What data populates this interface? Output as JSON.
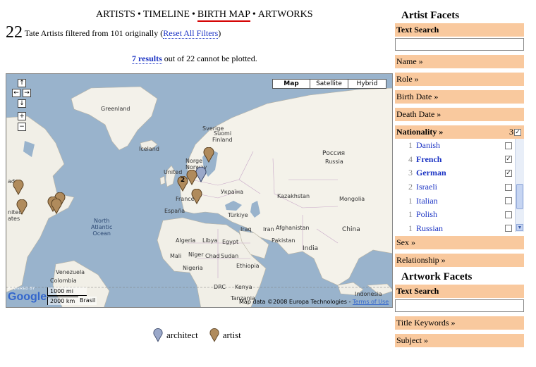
{
  "nav": {
    "items": [
      {
        "label": "ARTISTS"
      },
      {
        "label": "TIMELINE"
      },
      {
        "label": "BIRTH MAP"
      },
      {
        "label": "ARTWORKS"
      }
    ],
    "separator": "•",
    "active": "BIRTH MAP"
  },
  "summary": {
    "count": "22",
    "text": "Tate Artists filtered from 101 originally (",
    "reset_link": "Reset All Filters",
    "close": ")"
  },
  "unplotted": {
    "link": "7 results",
    "text": "out of 22 cannot be plotted."
  },
  "map": {
    "type_buttons": {
      "map": "Map",
      "satellite": "Satellite",
      "hybrid": "Hybrid"
    },
    "controls": {
      "up": "↑",
      "left": "←",
      "right": "→",
      "down": "↓",
      "zoom_in": "+",
      "zoom_out": "−"
    },
    "labels": {
      "greenland": "Greenland",
      "iceland": "Iceland",
      "sweden": "Sverige",
      "suomi": "Suomi",
      "finland": "Finland",
      "norway": "Norge",
      "norway_en": "Norway",
      "russia": "Россия",
      "russia_en": "Russia",
      "uk": "United",
      "ukraine": "Україна",
      "kazakhstan": "Kazakhstan",
      "mongolia": "Mongolia",
      "france": "France",
      "espana": "España",
      "turkiye": "Türkiye",
      "china": "China",
      "afghanistan": "Afghanistan",
      "iraq": "Iraq",
      "iran": "Iran",
      "pakistan": "Pakistan",
      "india": "India",
      "algeria": "Algeria",
      "libya": "Libya",
      "egypt": "Egypt",
      "mali": "Mali",
      "niger": "Niger",
      "chad": "Chad",
      "sudan": "Sudan",
      "ethiopia": "Ethiopia",
      "nigeria": "Nigeria",
      "drc": "DRC",
      "kenya": "Kenya",
      "tanzania": "Tanzania",
      "venezuela": "Venezuela",
      "colombia": "Colombia",
      "brasil": "Brasil",
      "indonesia": "Indonesia",
      "north_atlantic": "North\nAtlantic\nOcean",
      "canada_frag": "ada",
      "us_frag": "nited\nates"
    },
    "scale": {
      "mi": "1000 mi",
      "km": "2000 km",
      "brasil": "Brasil"
    },
    "logo": {
      "powered": "POWERED BY",
      "name": "Google"
    },
    "attribution": "Map data ©2008 Europa Technologies -",
    "terms_link": "Terms of Use",
    "cluster_label": "2"
  },
  "legend": {
    "architect": "architect",
    "artist": "artist",
    "colors": {
      "architect": "#9aa8c9",
      "artist": "#b08b5c"
    }
  },
  "facets": {
    "artist_title": "Artist Facets",
    "text_search": "Text Search",
    "name": "Name »",
    "role": "Role »",
    "birth_date": "Birth Date »",
    "death_date": "Death Date »",
    "nationality": "Nationality »",
    "nationality_count": "3",
    "nationalities": [
      {
        "count": "1",
        "label": "Danish",
        "selected": false
      },
      {
        "count": "4",
        "label": "French",
        "selected": true
      },
      {
        "count": "3",
        "label": "German",
        "selected": true
      },
      {
        "count": "2",
        "label": "Israeli",
        "selected": false
      },
      {
        "count": "1",
        "label": "Italian",
        "selected": false
      },
      {
        "count": "1",
        "label": "Polish",
        "selected": false
      },
      {
        "count": "1",
        "label": "Russian",
        "selected": false
      }
    ],
    "sex": "Sex »",
    "relationship": "Relationship »",
    "artwork_title": "Artwork Facets",
    "artwork_text_search": "Text Search",
    "title_keywords": "Title Keywords »",
    "subject": "Subject »",
    "check": "✓"
  }
}
